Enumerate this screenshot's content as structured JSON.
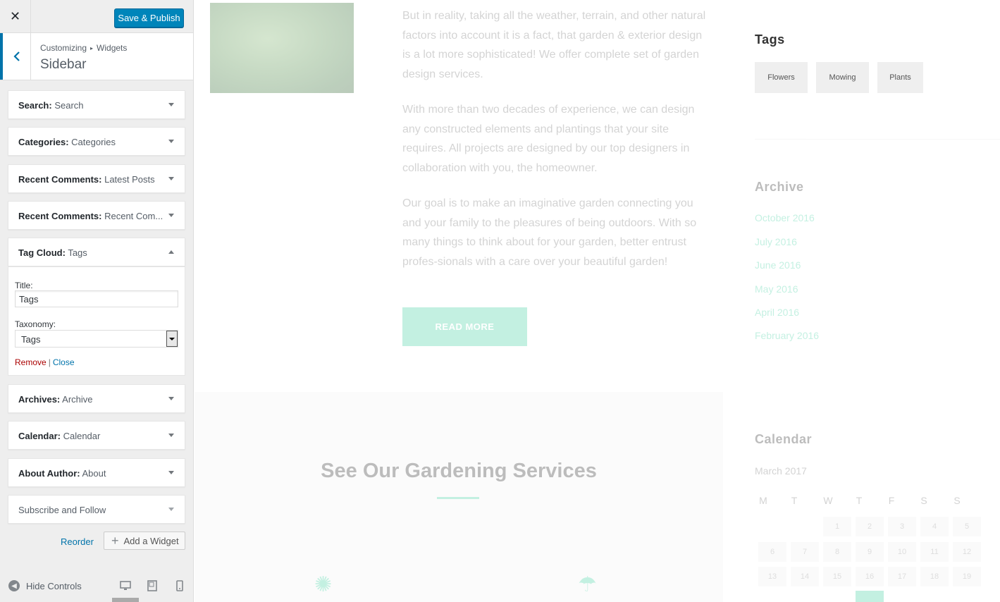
{
  "header": {
    "close_icon": "close-icon",
    "save_label": "Save & Publish"
  },
  "section": {
    "crumb_parent": "Customizing",
    "crumb_sep": "▸",
    "crumb_current": "Widgets",
    "title": "Sidebar"
  },
  "widgets": [
    {
      "type": "Search:",
      "instance": "Search",
      "open": false
    },
    {
      "type": "Categories:",
      "instance": "Categories",
      "open": false
    },
    {
      "type": "Recent Comments:",
      "instance": "Latest Posts",
      "open": false
    },
    {
      "type": "Recent Comments:",
      "instance": "Recent Com...",
      "open": false
    },
    {
      "type": "Tag Cloud:",
      "instance": "Tags",
      "open": true
    },
    {
      "type": "Archives:",
      "instance": "Archive",
      "open": false
    },
    {
      "type": "Calendar:",
      "instance": "Calendar",
      "open": false
    },
    {
      "type": "About Author:",
      "instance": "About",
      "open": false
    },
    {
      "type": "Subscribe and Follow",
      "instance": "",
      "open": false
    }
  ],
  "tag_widget_form": {
    "title_label": "Title:",
    "title_value": "Tags",
    "taxonomy_label": "Taxonomy:",
    "taxonomy_value": "Tags",
    "remove_label": "Remove",
    "separator": "|",
    "close_label": "Close"
  },
  "actions": {
    "reorder_label": "Reorder",
    "add_widget_label": "Add a Widget"
  },
  "footer": {
    "hide_controls_label": "Hide Controls",
    "devices": [
      "desktop-icon",
      "tablet-icon",
      "mobile-icon"
    ]
  },
  "preview": {
    "paragraphs": [
      "But in reality, taking all the weather, terrain, and other natural factors into account it is a fact, that garden & exterior design is a lot more sophisticated! We offer complete set of garden design services.",
      "With more than two decades of experience, we can design any constructed elements and plantings that your site requires. All projects are designed by our top designers in collaboration with you, the homeowner.",
      "Our goal is to make an imaginative garden connecting you and your family to the pleasures of being outdoors. With so many things to think about for your garden, better entrust profes-sionals with a care over your beautiful garden!"
    ],
    "read_more": "READ MORE",
    "services_title": "See Our Gardening Services",
    "tags_title": "Tags",
    "tags": [
      "Flowers",
      "Mowing",
      "Plants"
    ],
    "archive_title": "Archive",
    "archive_links": [
      "October 2016",
      "July 2016",
      "June 2016",
      "May 2016",
      "April 2016",
      "February 2016"
    ],
    "calendar_title": "Calendar",
    "calendar_month": "March 2017",
    "calendar_days": [
      "M",
      "T",
      "W",
      "T",
      "F",
      "S",
      "S"
    ],
    "calendar_dates": [
      "1",
      "2",
      "3",
      "4",
      "5",
      "6",
      "7",
      "8",
      "9",
      "10",
      "11",
      "12",
      "13",
      "14",
      "15",
      "16",
      "17",
      "18",
      "19"
    ]
  },
  "colors": {
    "primary_button": "#0085ba",
    "link": "#0073aa",
    "remove": "#aa0000",
    "accent_preview": "#49d1a5"
  }
}
